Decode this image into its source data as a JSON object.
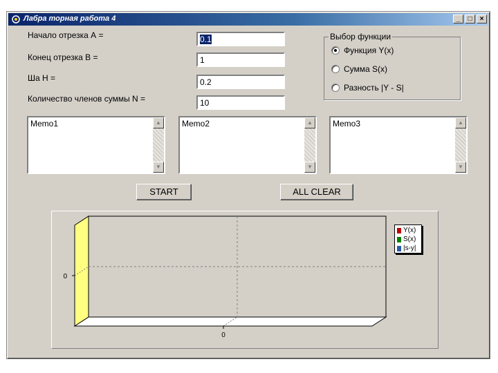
{
  "window": {
    "title": "Лабра торная работа 4",
    "minimize": "_",
    "maximize": "□",
    "close": "×"
  },
  "inputs": {
    "a": {
      "label": "Начало отрезка А =",
      "value": "0.1"
    },
    "b": {
      "label": "Конец отрезка В =",
      "value": "1"
    },
    "h": {
      "label": "Ша  Н =",
      "value": "0.2"
    },
    "n": {
      "label": "Количество членов суммы  N =",
      "value": "10"
    }
  },
  "function_group": {
    "title": "Выбор функции",
    "options": [
      {
        "label": "Функция Y(x)",
        "selected": true
      },
      {
        "label": "Сумма S(x)",
        "selected": false
      },
      {
        "label": "Разность |Y - S|",
        "selected": false
      }
    ]
  },
  "memos": [
    "Memo1",
    "Memo2",
    "Memo3"
  ],
  "buttons": {
    "start": "START",
    "clear": "ALL CLEAR"
  },
  "chart_data": {
    "type": "line",
    "series": [
      {
        "name": "Y(x)",
        "color": "#c00000",
        "values": []
      },
      {
        "name": "S(x)",
        "color": "#008000",
        "values": []
      },
      {
        "name": "|s-y|",
        "color": "#2a5aa8",
        "values": []
      }
    ],
    "y_tick_label": "0",
    "x_tick_label": "0",
    "wall_color": "#ffff80",
    "grid": true,
    "legend_position": "top-right"
  }
}
